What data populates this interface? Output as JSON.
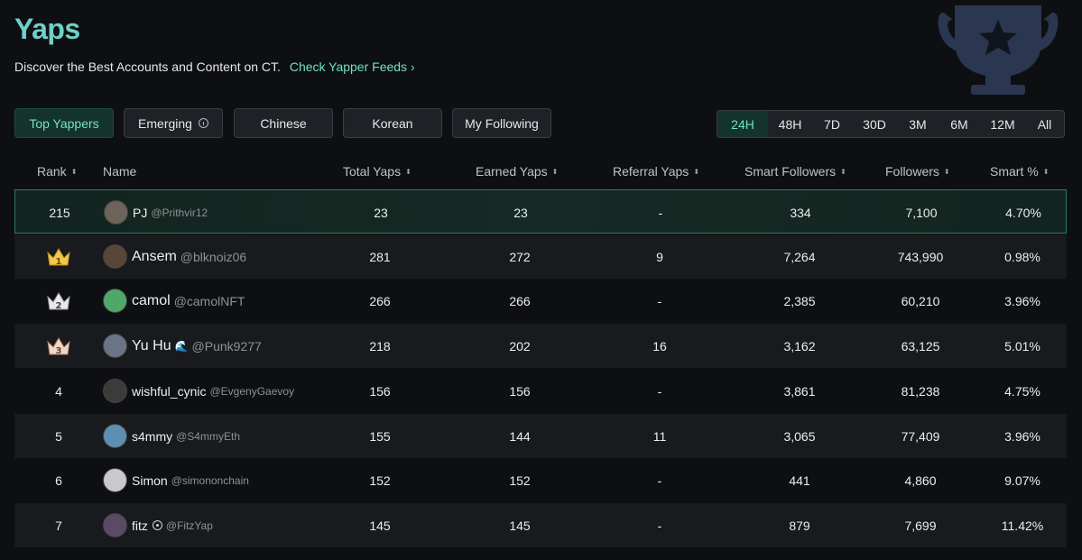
{
  "header": {
    "title": "Yaps",
    "subtitle": "Discover the Best Accounts and Content on CT.",
    "feed_link": "Check Yapper Feeds ›"
  },
  "filters": [
    {
      "label": "Top Yappers",
      "active": true
    },
    {
      "label": "Emerging",
      "active": false,
      "info_icon": "info-icon"
    },
    {
      "label": "Chinese",
      "active": false
    },
    {
      "label": "Korean",
      "active": false
    },
    {
      "label": "My Following",
      "active": false
    }
  ],
  "periods": [
    {
      "label": "24H",
      "active": true
    },
    {
      "label": "48H",
      "active": false
    },
    {
      "label": "7D",
      "active": false
    },
    {
      "label": "30D",
      "active": false
    },
    {
      "label": "3M",
      "active": false
    },
    {
      "label": "6M",
      "active": false
    },
    {
      "label": "12M",
      "active": false
    },
    {
      "label": "All",
      "active": false
    }
  ],
  "columns": {
    "rank": "Rank",
    "name": "Name",
    "total": "Total Yaps",
    "earned": "Earned Yaps",
    "referral": "Referral Yaps",
    "smart": "Smart Followers",
    "followers": "Followers",
    "pct": "Smart %",
    "sort_glyph": "⬍"
  },
  "rows": [
    {
      "rank": "215",
      "name": "PJ",
      "handle": "@Prithvir12",
      "total": "23",
      "earned": "23",
      "referral": "-",
      "smart": "334",
      "followers": "7,100",
      "pct": "4.70%",
      "avatar_color": "#6b6458"
    },
    {
      "rank": "1",
      "name": "Ansem",
      "handle": "@blknoiz06",
      "total": "281",
      "earned": "272",
      "referral": "9",
      "smart": "7,264",
      "followers": "743,990",
      "pct": "0.98%",
      "avatar_color": "#5a4636"
    },
    {
      "rank": "2",
      "name": "camol",
      "handle": "@camolNFT",
      "total": "266",
      "earned": "266",
      "referral": "-",
      "smart": "2,385",
      "followers": "60,210",
      "pct": "3.96%",
      "avatar_color": "#4fa86a"
    },
    {
      "rank": "3",
      "name": "Yu Hu",
      "badge": "🌊",
      "handle": "@Punk9277",
      "total": "218",
      "earned": "202",
      "referral": "16",
      "smart": "3,162",
      "followers": "63,125",
      "pct": "5.01%",
      "avatar_color": "#6a7488"
    },
    {
      "rank": "4",
      "name": "wishful_cynic",
      "handle": "@EvgenyGaevoy",
      "total": "156",
      "earned": "156",
      "referral": "-",
      "smart": "3,861",
      "followers": "81,238",
      "pct": "4.75%",
      "avatar_color": "#3d3a3a"
    },
    {
      "rank": "5",
      "name": "s4mmy",
      "handle": "@S4mmyEth",
      "total": "155",
      "earned": "144",
      "referral": "11",
      "smart": "3,065",
      "followers": "77,409",
      "pct": "3.96%",
      "avatar_color": "#5f8fb0"
    },
    {
      "rank": "6",
      "name": "Simon",
      "handle": "@simononchain",
      "total": "152",
      "earned": "152",
      "referral": "-",
      "smart": "441",
      "followers": "4,860",
      "pct": "9.07%",
      "avatar_color": "#c9c9cc"
    },
    {
      "rank": "7",
      "name": "fitz",
      "handle": "@FitzYap",
      "total": "145",
      "earned": "145",
      "referral": "-",
      "smart": "879",
      "followers": "7,699",
      "pct": "11.42%",
      "avatar_color": "#5a4a66"
    }
  ],
  "colors": {
    "accent": "#6fd0c9",
    "active_bg": "#15332d",
    "active_text": "#71e3c4",
    "crown_gold": "#f3c94a",
    "crown_silver": "#e9e9ec",
    "crown_bronze": "#f2d7c7"
  }
}
